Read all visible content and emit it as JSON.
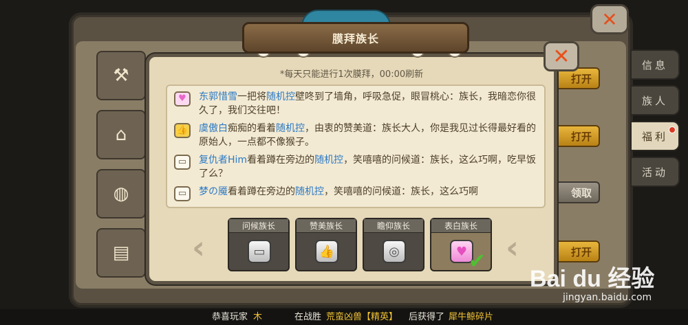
{
  "outer": {
    "close_icon": "close-x-icon",
    "side_tabs": [
      {
        "label": "信息",
        "active": false,
        "badge": false
      },
      {
        "label": "族人",
        "active": false,
        "badge": false
      },
      {
        "label": "福利",
        "active": true,
        "badge": true
      },
      {
        "label": "活动",
        "active": false,
        "badge": false
      }
    ],
    "right_buttons": [
      "打开",
      "打开",
      "领取",
      "打开"
    ]
  },
  "dialog": {
    "title": "膜拜族长",
    "notice": "*每天只能进行1次膜拜，00:00刷新",
    "messages": [
      {
        "icon": "heart",
        "name": "东郭惜雪",
        "pre": "一把将",
        "target": "随机控",
        "text": "壁咚到了墙角，呼吸急促，眼冒桃心：族长，我暗恋你很久了，我们交往吧！"
      },
      {
        "icon": "thumb",
        "name": "虞傲白",
        "pre": "痴痴的看着",
        "target": "随机控",
        "text": "，由衷的赞美道：族长大人，你是我见过长得最好看的原始人，一点都不像猴子。"
      },
      {
        "icon": "chat",
        "name": "复仇者Him",
        "pre": "看着蹲在旁边的",
        "target": "随机控",
        "text": "，笑嘻嘻的问候道：族长，这么巧啊，吃早饭了么？"
      },
      {
        "icon": "chat",
        "name": "梦の魇",
        "pre": "看着蹲在旁边的",
        "target": "随机控",
        "text": "，笑嘻嘻的问候道：族长，这么巧啊"
      }
    ],
    "actions": [
      {
        "label": "问候族长",
        "icon": "chat-bubble-icon",
        "selected": false
      },
      {
        "label": "赞美族长",
        "icon": "thumbs-up-icon",
        "selected": false
      },
      {
        "label": "瞻仰族长",
        "icon": "ring-icon",
        "selected": false
      },
      {
        "label": "表白族长",
        "icon": "heart-icon",
        "selected": true
      }
    ]
  },
  "ticker": {
    "prefix": "恭喜玩家",
    "player": "木",
    "mid1": "在战胜",
    "monster": "荒蛮凶兽【精英】",
    "mid2": "后获得了",
    "item": "犀牛鲸碎片"
  },
  "watermark": {
    "logo": "Bai du 经验",
    "url": "jingyan.baidu.com"
  }
}
